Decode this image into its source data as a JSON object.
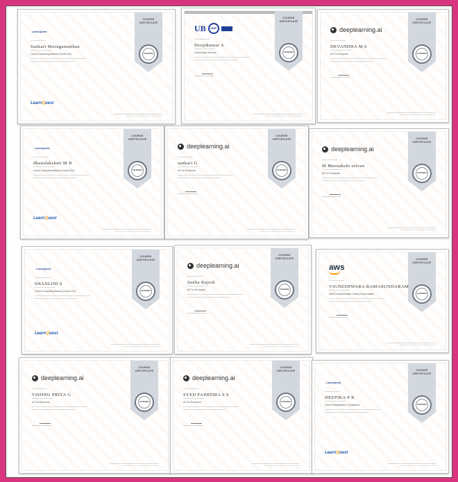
{
  "ribbon": {
    "line1": "COURSE",
    "line2": "CERTIFICATE"
  },
  "seal_text": "COURSERA",
  "certificates": [
    {
      "id": "c1",
      "logo": "learnquest",
      "name": "Sankari Murugananthan",
      "course": "Cloud Computing Basics (Cloud 101)"
    },
    {
      "id": "c2",
      "logo": "ub",
      "logo_text": "UB",
      "logo_badge": "UMP",
      "name": "Deepikumar A",
      "course": "Cloud Data Science"
    },
    {
      "id": "c3",
      "logo": "deeplearning",
      "logo_text": "deeplearning.ai",
      "name": "DEVANDHA M.S",
      "course": "AI For Everyone"
    },
    {
      "id": "c4",
      "logo": "learnquest",
      "name": "dhanalakshmi M R",
      "course": "Cloud Computing Basics (Cloud 101)"
    },
    {
      "id": "c5",
      "logo": "deeplearning",
      "logo_text": "deeplearning.ai",
      "name": "sankari G",
      "course": "AI For Everyone"
    },
    {
      "id": "c6",
      "logo": "deeplearning",
      "logo_text": "deeplearning.ai",
      "name": "M Meenakshi selvan",
      "course": "AI For Everyone"
    },
    {
      "id": "c7",
      "logo": "learnquest",
      "name": "SHANLINI S",
      "course": "Cloud Computing Basics (Cloud 101)"
    },
    {
      "id": "c8",
      "logo": "deeplearning",
      "logo_text": "deeplearning.ai",
      "name": "Sneha Rajesh",
      "course": "AI For Everyone"
    },
    {
      "id": "c9",
      "logo": "aws",
      "logo_text": "aws",
      "name": "VIGNESHWARA RAMASUNDARAM",
      "course": "AWS Fundamentals: Going Cloud-Native"
    },
    {
      "id": "c10",
      "logo": "deeplearning",
      "logo_text": "deeplearning.ai",
      "name": "VISHNU PRIYA G",
      "course": "AI For Everyone"
    },
    {
      "id": "c11",
      "logo": "deeplearning",
      "logo_text": "deeplearning.ai",
      "name": "SYED FAHEEMA S S",
      "course": "AI For Everyone"
    },
    {
      "id": "c12",
      "logo": "learnquest",
      "name": "DEEPIKA P K",
      "course": "Cloud Virtualization, Containers"
    }
  ]
}
